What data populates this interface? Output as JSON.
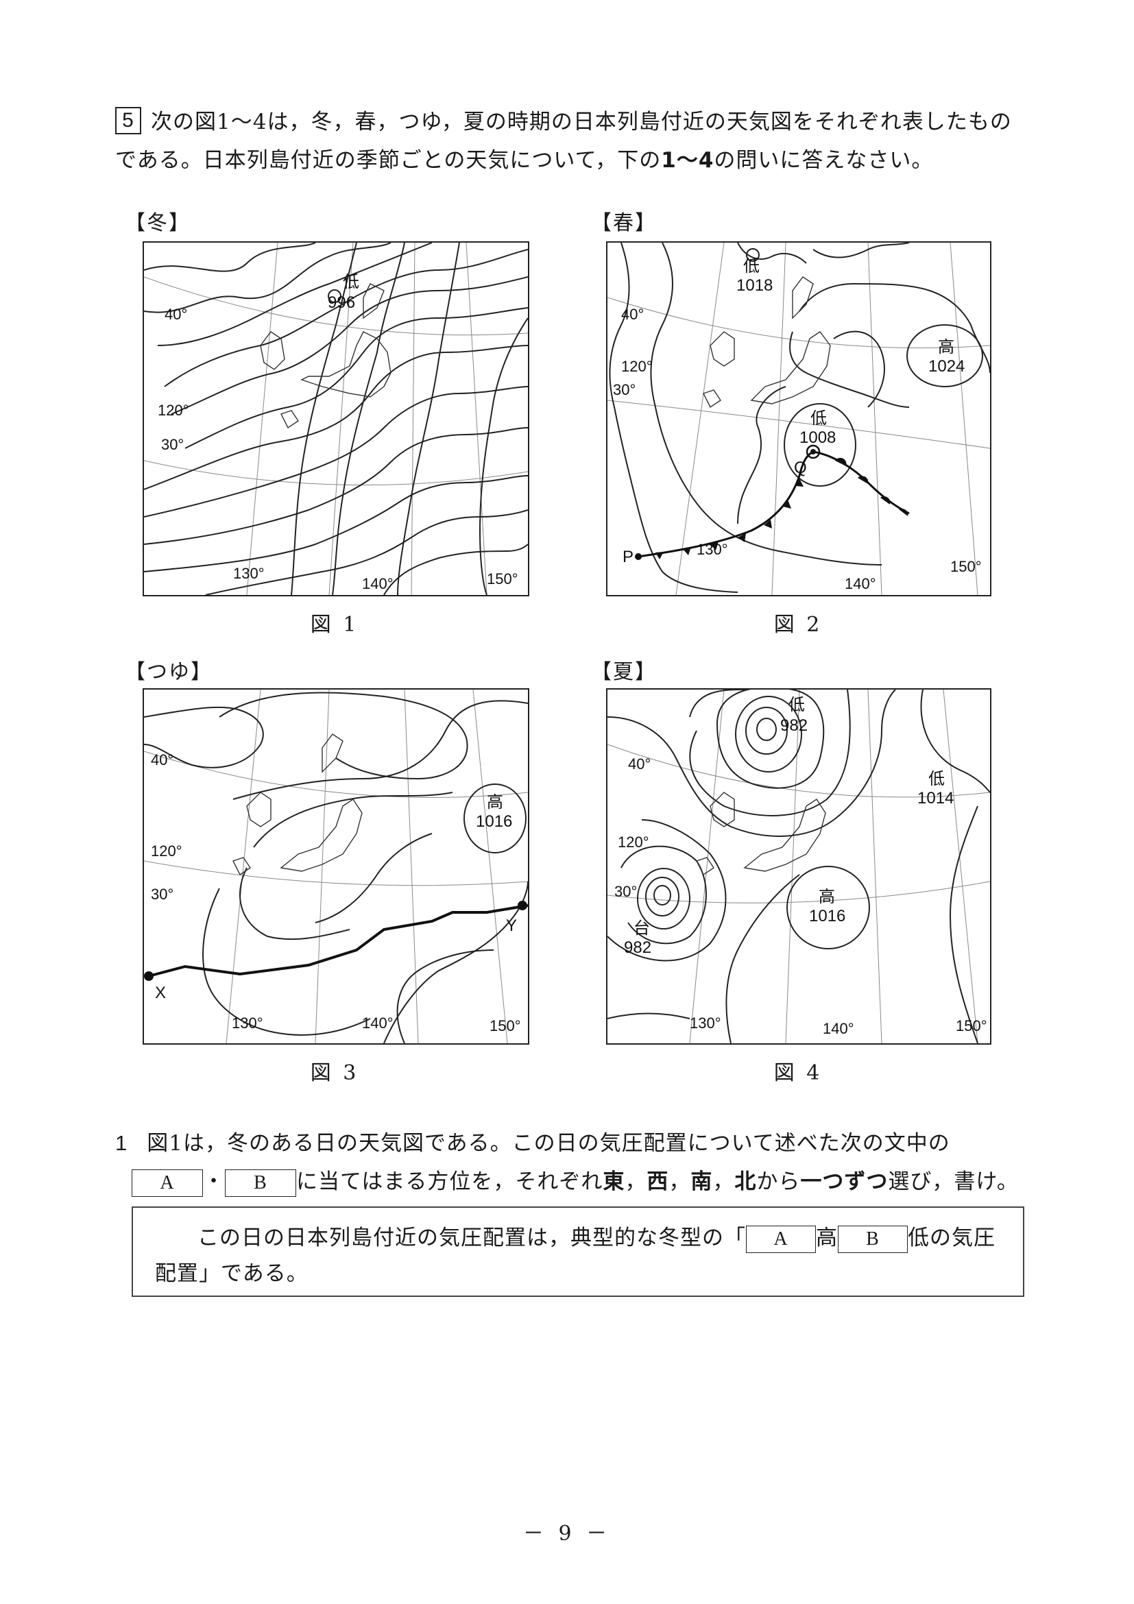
{
  "question": {
    "number": "5",
    "intro_line1": "次の図1～4は，冬，春，つゆ，夏の時期の日本列島付近の天気図をそれぞれ表したもの",
    "intro_line2_a": "である。日本列島付近の季節ごとの天気について，下の",
    "intro_line2_bold": "1～4",
    "intro_line2_b": "の問いに答えなさい。"
  },
  "maps": [
    {
      "season": "【冬】",
      "caption": "図 1",
      "lat_labels": [
        "40°",
        "30°"
      ],
      "lon_labels": [
        "120°",
        "130°",
        "140°",
        "150°"
      ],
      "pressure_systems": [
        {
          "kind": "低",
          "value": "996"
        }
      ],
      "points": []
    },
    {
      "season": "【春】",
      "caption": "図 2",
      "lat_labels": [
        "40°",
        "30°"
      ],
      "lon_labels": [
        "120°",
        "130°",
        "140°",
        "150°"
      ],
      "pressure_systems": [
        {
          "kind": "低",
          "value": "1018"
        },
        {
          "kind": "高",
          "value": "1024"
        },
        {
          "kind": "低",
          "value": "1008"
        }
      ],
      "points": [
        "P",
        "Q"
      ]
    },
    {
      "season": "【つゆ】",
      "caption": "図 3",
      "lat_labels": [
        "40°",
        "30°"
      ],
      "lon_labels": [
        "120°",
        "130°",
        "140°",
        "150°"
      ],
      "pressure_systems": [
        {
          "kind": "高",
          "value": "1016"
        }
      ],
      "points": [
        "X",
        "Y"
      ]
    },
    {
      "season": "【夏】",
      "caption": "図 4",
      "lat_labels": [
        "40°",
        "30°"
      ],
      "lon_labels": [
        "120°",
        "130°",
        "140°",
        "150°"
      ],
      "pressure_systems": [
        {
          "kind": "低",
          "value": "982"
        },
        {
          "kind": "低",
          "value": "1014"
        },
        {
          "kind": "高",
          "value": "1016"
        },
        {
          "kind": "台",
          "value": "982"
        }
      ],
      "points": []
    }
  ],
  "sub_question_1": {
    "number": "1",
    "line1": "図1は，冬のある日の天気図である。この日の気圧配置について述べた次の文中の",
    "box_a": "A",
    "dot": "・",
    "box_b": "B",
    "line2_a": "に当てはまる方位を，それぞれ",
    "dir_e": "東",
    "comma": "，",
    "dir_w": "西",
    "dir_s": "南",
    "dir_n": "北",
    "line2_b": "から",
    "each_one": "一つずつ",
    "line2_c": "選び，書け。",
    "frame_text1": "この日の日本列島付近の気圧配置は，典型的な冬型の「",
    "frame_kou": "高",
    "frame_tei_rest": "低の気圧",
    "frame_text2": "配置」である。"
  },
  "page_number": "－ 9 －"
}
